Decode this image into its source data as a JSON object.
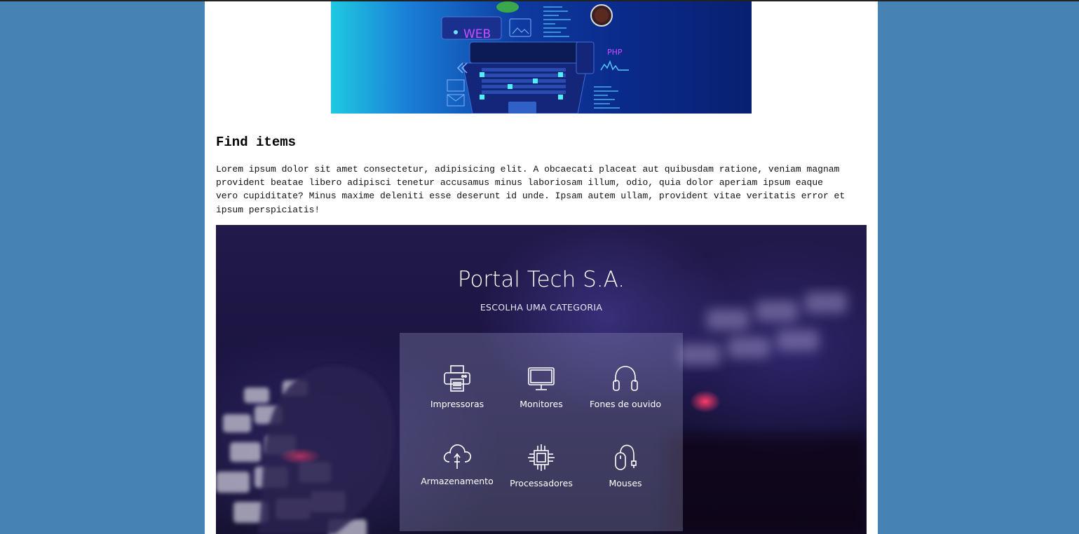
{
  "banner": {
    "web_label": "WEB",
    "php_label": "PHP"
  },
  "section": {
    "title": "Find items",
    "text": "Lorem ipsum dolor sit amet consectetur, adipisicing elit. A obcaecati placeat aut quibusdam ratione, veniam magnam provident beatae libero adipisci tenetur accusamus minus laboriosam illum, odio, quia dolor aperiam ipsum eaque vero cupiditate? Minus maxime deleniti esse deserunt id unde. Ipsam autem ullam, provident vitae veritatis error et ipsum perspiciatis!"
  },
  "hero": {
    "title": "Portal Tech S.A.",
    "subtitle": "ESCOLHA UMA CATEGORIA",
    "categories": [
      {
        "label": "Impressoras",
        "icon": "printer-icon"
      },
      {
        "label": "Monitores",
        "icon": "monitor-icon"
      },
      {
        "label": "Fones de ouvido",
        "icon": "headphones-icon"
      },
      {
        "label": "Armazenamento",
        "icon": "cloud-upload-icon"
      },
      {
        "label": "Processadores",
        "icon": "processor-icon"
      },
      {
        "label": "Mouses",
        "icon": "mouse-icon"
      }
    ]
  }
}
